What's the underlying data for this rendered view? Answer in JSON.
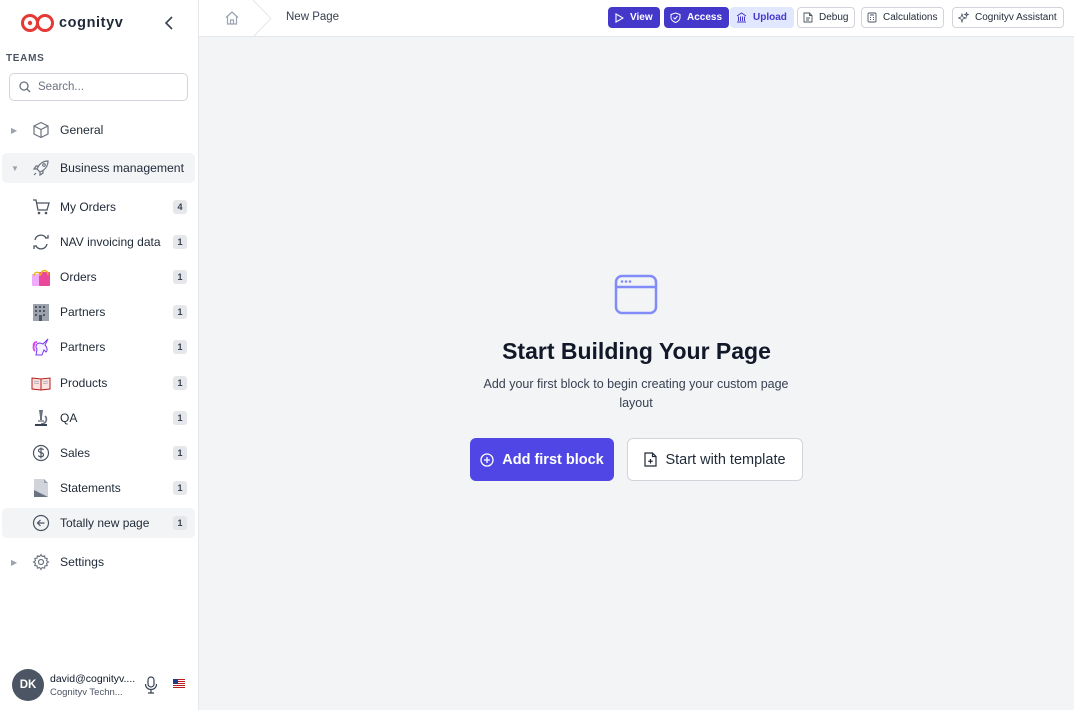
{
  "app": {
    "logo_text": "cognityv",
    "brand_color": "#e53935"
  },
  "sidebar": {
    "teams_label": "TEAMS",
    "search": {
      "placeholder": "Search...",
      "value": ""
    },
    "items": [
      {
        "label": "General",
        "icon": "cube-icon",
        "expanded": false
      },
      {
        "label": "Business management",
        "icon": "rocket-icon",
        "expanded": true,
        "children": [
          {
            "label": "My Orders",
            "icon": "cart-icon",
            "count": "4"
          },
          {
            "label": "NAV invoicing data",
            "icon": "refresh-icon",
            "count": "1"
          },
          {
            "label": "Orders",
            "icon": "shopping-bags-icon",
            "count": "1"
          },
          {
            "label": "Partners",
            "icon": "office-building-icon",
            "count": "1"
          },
          {
            "label": "Partners",
            "icon": "unicorn-icon",
            "count": "1"
          },
          {
            "label": "Products",
            "icon": "open-book-icon",
            "count": "1"
          },
          {
            "label": "QA",
            "icon": "microscope-icon",
            "count": "1"
          },
          {
            "label": "Sales",
            "icon": "dollar-circle-icon",
            "count": "1"
          },
          {
            "label": "Statements",
            "icon": "document-icon",
            "count": "1"
          },
          {
            "label": "Totally new page",
            "icon": "arrow-left-circle-icon",
            "count": "1",
            "active": true
          }
        ]
      },
      {
        "label": "Settings",
        "icon": "gear-icon",
        "expanded": false
      }
    ],
    "user": {
      "initials": "DK",
      "email": "david@cognityv....",
      "org": "Cognityv Techn..."
    }
  },
  "topbar": {
    "breadcrumb_current": "New Page",
    "buttons": {
      "view": "View",
      "access": "Access",
      "upload": "Upload",
      "debug": "Debug",
      "calculations": "Calculations",
      "assistant": "Cognityv Assistant"
    }
  },
  "main": {
    "empty_title": "Start Building Your Page",
    "empty_description": "Add your first block to begin creating your custom page layout",
    "add_block_label": "Add first block",
    "template_label": "Start with template"
  },
  "colors": {
    "primary": "#4f46e5",
    "primary_dark": "#4338ca",
    "soft_primary": "#e0e7ff",
    "empty_icon": "#818cf8",
    "background": "#f3f4f6"
  }
}
